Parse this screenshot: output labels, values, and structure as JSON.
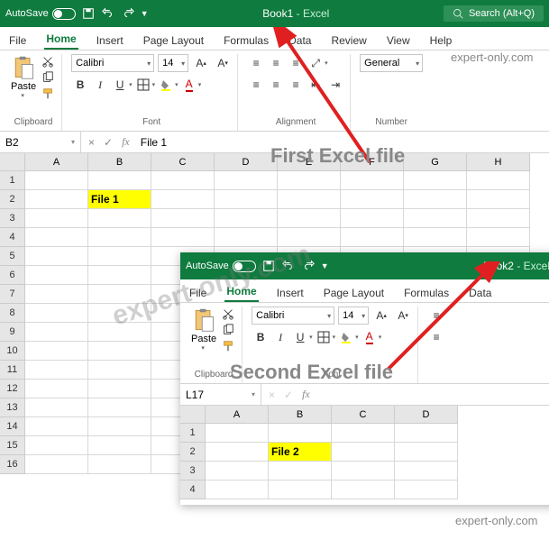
{
  "window1": {
    "autosave_label": "AutoSave",
    "autosave_state": "Off",
    "title_book": "Book1",
    "title_suffix": " -  Excel",
    "search_placeholder": "Search (Alt+Q)",
    "tabs": [
      "File",
      "Home",
      "Insert",
      "Page Layout",
      "Formulas",
      "Data",
      "Review",
      "View",
      "Help"
    ],
    "active_tab": "Home",
    "clipboard_label": "Clipboard",
    "paste_label": "Paste",
    "font_group_label": "Font",
    "font_name": "Calibri",
    "font_size": "14",
    "alignment_label": "Alignment",
    "number_label": "Number",
    "number_format": "General",
    "namebox": "B2",
    "formula": "File 1",
    "cols": [
      "A",
      "B",
      "C",
      "D",
      "E",
      "F",
      "G",
      "H"
    ],
    "rows": [
      "1",
      "2",
      "3",
      "4",
      "5",
      "6",
      "7",
      "8",
      "9",
      "10",
      "11",
      "12",
      "13",
      "14",
      "15",
      "16"
    ],
    "highlighted_cell": {
      "row": 2,
      "col": "B",
      "text": "File 1"
    }
  },
  "window2": {
    "autosave_label": "AutoSave",
    "autosave_state": "Off",
    "title_book": "Book2",
    "title_suffix": " -  Excel",
    "tabs": [
      "File",
      "Home",
      "Insert",
      "Page Layout",
      "Formulas",
      "Data"
    ],
    "active_tab": "Home",
    "clipboard_label": "Clipboard",
    "paste_label": "Paste",
    "font_group_label": "Font",
    "font_name": "Calibri",
    "font_size": "14",
    "namebox": "L17",
    "formula": "",
    "cols": [
      "A",
      "B",
      "C",
      "D"
    ],
    "rows": [
      "1",
      "2",
      "3",
      "4"
    ],
    "highlighted_cell": {
      "row": 2,
      "col": "B",
      "text": "File 2"
    }
  },
  "annotations": {
    "first": "First Excel file",
    "second": "Second Excel file",
    "watermark": "expert-only.com",
    "wm_small": "expert-only.com"
  }
}
